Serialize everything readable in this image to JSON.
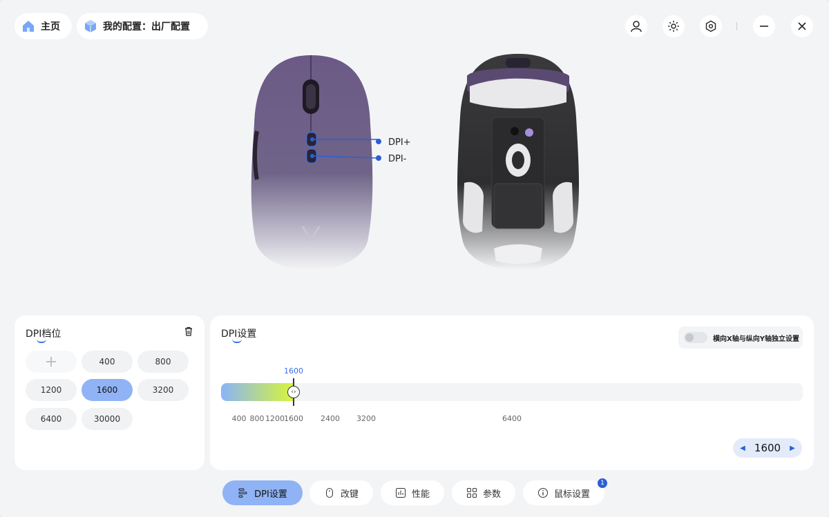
{
  "header": {
    "home_label": "主页",
    "config_label": "我的配置：出厂配置",
    "icons": [
      "user-icon",
      "brightness-icon",
      "settings-hex-icon",
      "minimize-icon",
      "close-icon"
    ]
  },
  "mouse": {
    "callouts": [
      "DPI+",
      "DPI-"
    ]
  },
  "dpi_levels": {
    "title": "DPI档位",
    "add_symbol": "+",
    "values": [
      "400",
      "800",
      "1200",
      "1600",
      "3200",
      "6400",
      "30000"
    ],
    "active": "1600"
  },
  "dpi_settings": {
    "title": "DPI设置",
    "toggle_label": "横向X轴与纵向Y轴独立设置",
    "toggle_on": false,
    "current_marker": "1600",
    "slider_fraction": 0.125,
    "ticks": [
      "400",
      "800",
      "1200",
      "1600",
      "2400",
      "3200",
      "6400"
    ],
    "stepper_value": "1600",
    "accent": "#3b6ee8"
  },
  "nav": {
    "tabs": [
      "DPI设置",
      "改键",
      "性能",
      "参数",
      "鼠标设置"
    ],
    "active": "DPI设置",
    "badge": "1"
  }
}
